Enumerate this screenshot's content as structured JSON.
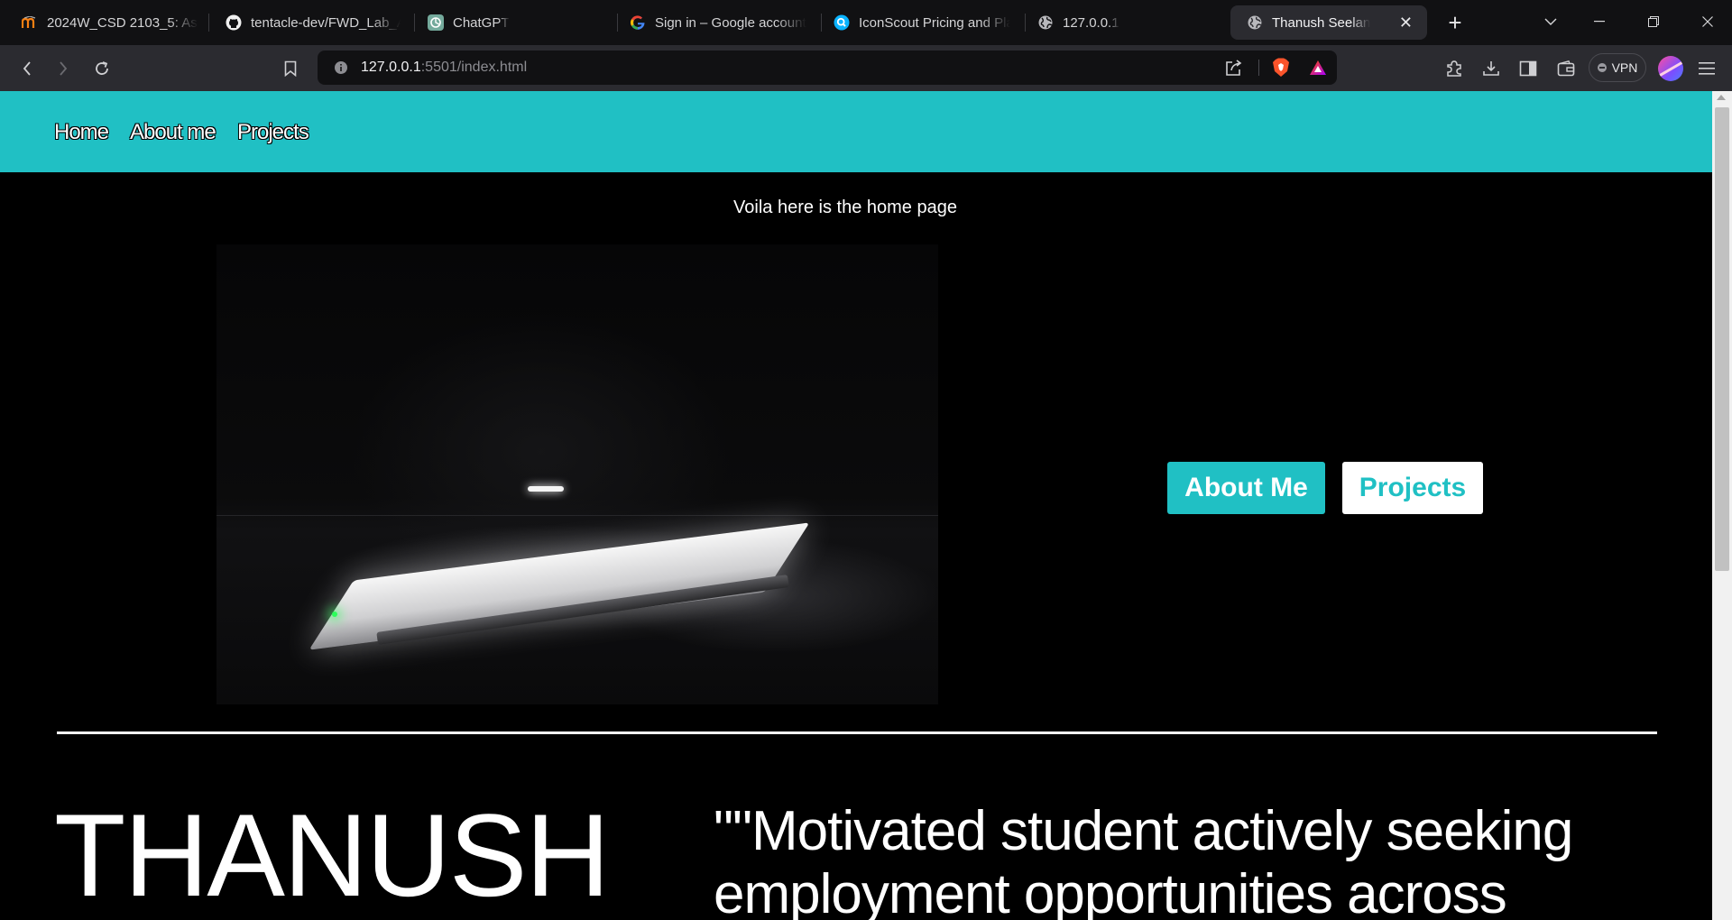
{
  "browser": {
    "tabs": [
      {
        "label": "2024W_CSD 2103_5: Assig",
        "icon": "moodle-icon"
      },
      {
        "label": "tentacle-dev/FWD_Lab_As",
        "icon": "github-icon"
      },
      {
        "label": "ChatGPT",
        "icon": "chatgpt-icon"
      },
      {
        "label": "Sign in – Google accounts",
        "icon": "google-icon"
      },
      {
        "label": "IconScout Pricing and Pla",
        "icon": "iconscout-icon"
      },
      {
        "label": "127.0.0.1",
        "icon": "globe-icon"
      },
      {
        "label": "Thanush Seelan",
        "icon": "globe-icon",
        "active": true
      }
    ],
    "url_host": "127.0.0.1",
    "url_path": ":5501/index.html",
    "vpn_label": "VPN"
  },
  "site": {
    "accent_color": "#20c0c4",
    "nav": [
      "Home",
      "About me",
      "Projects"
    ],
    "caption": "Voila here is the home page",
    "buttons": {
      "about": "About Me",
      "projects": "Projects"
    },
    "name": "THANUSH",
    "quote": "\"\"Motivated student actively seeking employment opportunities across"
  }
}
